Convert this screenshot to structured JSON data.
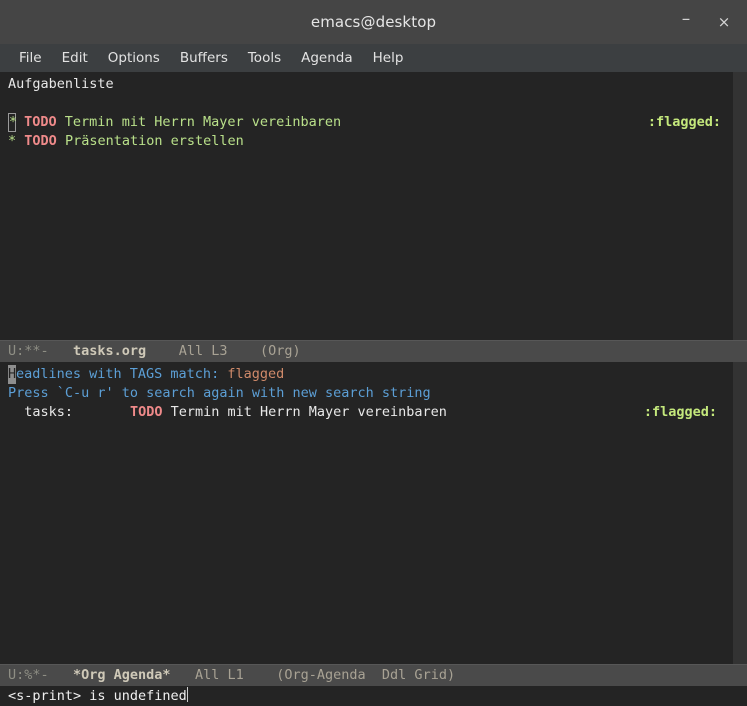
{
  "titlebar": {
    "title": "emacs@desktop",
    "minimize_label": "–",
    "close_label": "×"
  },
  "menubar": {
    "items": [
      {
        "label": "File"
      },
      {
        "label": "Edit"
      },
      {
        "label": "Options"
      },
      {
        "label": "Buffers"
      },
      {
        "label": "Tools"
      },
      {
        "label": "Agenda"
      },
      {
        "label": "Help"
      }
    ]
  },
  "tasks_window": {
    "title_line": "Aufgabenliste",
    "items": [
      {
        "bullet": "*",
        "keyword": "TODO",
        "headline": "Termin mit Herrn Mayer vereinbaren",
        "tags": ":flagged:"
      },
      {
        "bullet": "*",
        "keyword": "TODO",
        "headline": "Präsentation erstellen",
        "tags": ""
      }
    ],
    "modeline": {
      "flags": "U:**-",
      "buffer": "tasks.org",
      "position": "All L3",
      "modes": "(Org)"
    }
  },
  "agenda_window": {
    "header_prefix": "Headlines with TAGS match: ",
    "header_match": "flagged",
    "hint_line": "Press `C-u r' to search again with new search string",
    "entries": [
      {
        "category": "  tasks:",
        "keyword": "TODO",
        "headline": "Termin mit Herrn Mayer vereinbaren",
        "tags": ":flagged:"
      }
    ],
    "modeline": {
      "flags": "U:%*-",
      "buffer": "*Org Agenda*",
      "position": "All L1",
      "modes": "(Org-Agenda  Ddl Grid)"
    }
  },
  "echo_area": {
    "message": "<s-print> is undefined"
  },
  "colors": {
    "titlebar_bg": "#454545",
    "menubar_bg": "#3c3f41",
    "buffer_bg": "#242424",
    "modeline_bg": "#4a4a4a",
    "todo_keyword": "#ef8a8a",
    "headline_text": "#b9e08a",
    "tag_text": "#c4e87c",
    "agenda_structure": "#5c9fd6",
    "agenda_match": "#d08a6a",
    "default_fg": "#e8e8e8"
  }
}
